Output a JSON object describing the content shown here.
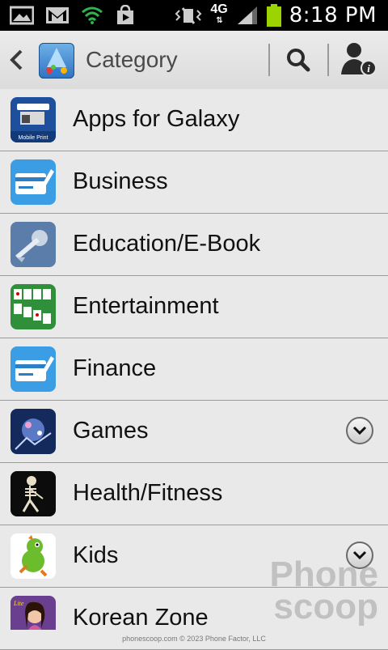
{
  "status_bar": {
    "time": "8:18 PM",
    "network": "4G"
  },
  "header": {
    "title": "Category",
    "back_icon": "back-chevron-icon",
    "logo_icon": "samsung-apps-logo-icon",
    "search_icon": "search-icon",
    "profile_icon": "profile-info-icon"
  },
  "categories": [
    {
      "label": "Apps for Galaxy",
      "icon": "apps-for-galaxy-icon",
      "expandable": false
    },
    {
      "label": "Business",
      "icon": "business-icon",
      "expandable": false
    },
    {
      "label": "Education/E-Book",
      "icon": "education-icon",
      "expandable": false
    },
    {
      "label": "Entertainment",
      "icon": "entertainment-icon",
      "expandable": false
    },
    {
      "label": "Finance",
      "icon": "finance-icon",
      "expandable": false
    },
    {
      "label": "Games",
      "icon": "games-icon",
      "expandable": true
    },
    {
      "label": "Health/Fitness",
      "icon": "health-fitness-icon",
      "expandable": false
    },
    {
      "label": "Kids",
      "icon": "kids-icon",
      "expandable": true
    },
    {
      "label": "Korean Zone",
      "icon": "korean-zone-icon",
      "expandable": false
    }
  ],
  "watermark": {
    "line1": "Phone",
    "line2": "scoop",
    "footer": "phonescoop.com  © 2023 Phone Factor, LLC"
  }
}
